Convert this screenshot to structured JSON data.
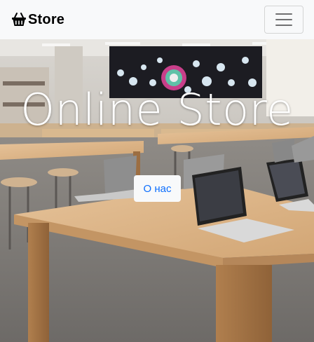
{
  "navbar": {
    "brand_text": "Store",
    "brand_icon": "basket-icon",
    "toggler_icon": "hamburger-menu-icon"
  },
  "hero": {
    "title": "Online Store",
    "button_label": "О нас",
    "accent_color": "#0d6efd"
  }
}
